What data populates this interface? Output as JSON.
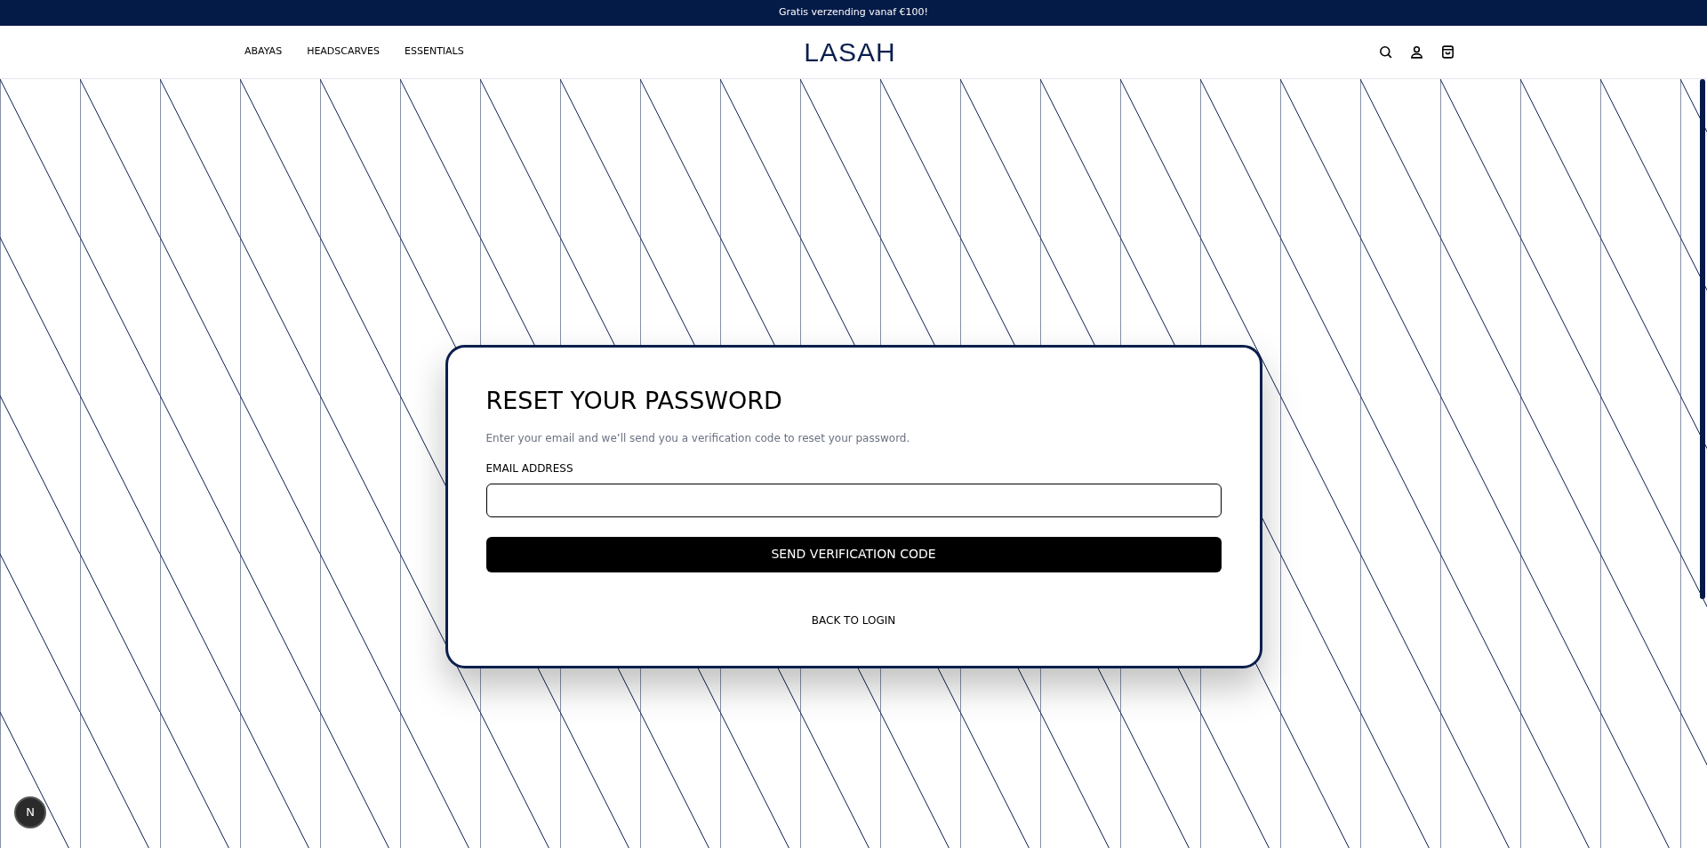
{
  "announcement": "Gratis verzending vanaf €100!",
  "nav": {
    "links": [
      "ABAYAS",
      "HEADSCARVES",
      "ESSENTIALS"
    ],
    "logo": "LASAH"
  },
  "form": {
    "title": "RESET YOUR PASSWORD",
    "description": "Enter your email and we’ll send you a verification code to reset your password.",
    "email_label": "EMAIL ADDRESS",
    "submit": "SEND VERIFICATION CODE",
    "back_link": "BACK TO LOGIN"
  },
  "dev_badge": "N"
}
